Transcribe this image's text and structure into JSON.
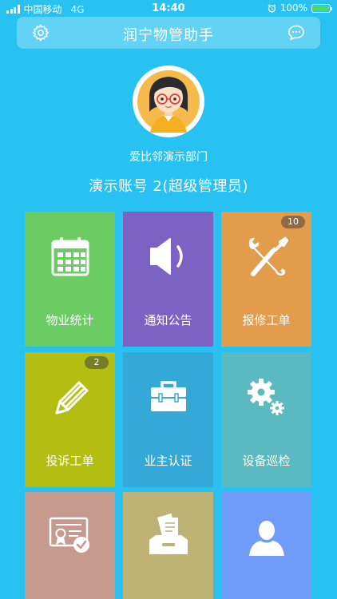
{
  "status_bar": {
    "carrier": "中国移动",
    "network": "4G",
    "time": "14:40",
    "battery": "100%"
  },
  "header": {
    "title": "润宁物管助手",
    "left_icon": "gear-icon",
    "right_icon": "chat-bubble-icon"
  },
  "profile": {
    "department": "爱比邻演示部门",
    "account": "演示账号 2(超级管理员)"
  },
  "tiles": [
    {
      "label": "物业统计",
      "icon": "calendar-icon",
      "color": "#6acc63",
      "badge": ""
    },
    {
      "label": "通知公告",
      "icon": "speaker-icon",
      "color": "#7c63c3",
      "badge": ""
    },
    {
      "label": "报修工单",
      "icon": "wrench-screwdriver-icon",
      "color": "#e39b4c",
      "badge": "10"
    },
    {
      "label": "投诉工单",
      "icon": "pencil-icon",
      "color": "#b3bd12",
      "badge": "2"
    },
    {
      "label": "业主认证",
      "icon": "toolbox-icon",
      "color": "#34a9d7",
      "badge": ""
    },
    {
      "label": "设备巡检",
      "icon": "gears-icon",
      "color": "#5abac0",
      "badge": ""
    },
    {
      "label": "",
      "icon": "certificate-icon",
      "color": "#c69a8d",
      "badge": ""
    },
    {
      "label": "",
      "icon": "document-tray-icon",
      "color": "#bfb275",
      "badge": ""
    },
    {
      "label": "",
      "icon": "user-icon",
      "color": "#6f9cf9",
      "badge": ""
    }
  ]
}
